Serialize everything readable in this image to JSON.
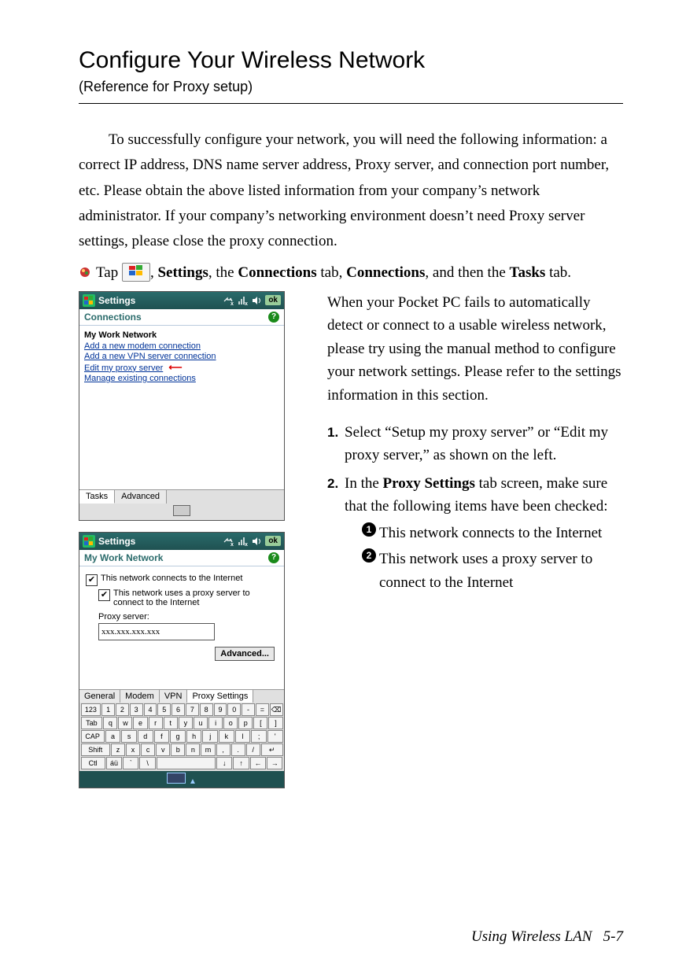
{
  "title": "Configure Your Wireless Network",
  "subtitle": "(Reference for Proxy setup)",
  "intro": "To successfully configure your network, you will need the following information: a correct IP address, DNS name server address, Proxy server, and connection port number, etc. Please obtain the above listed information from your company’s network administrator. If your company’s networking environment doesn’t need Proxy server settings, please close the proxy connection.",
  "instruction": {
    "pre": "Tap ",
    "post1": ", ",
    "settings": "Settings",
    "post2": ", the ",
    "connections_tab": "Connections",
    "post3": " tab, ",
    "connections": "Connections",
    "post4": ", and then the ",
    "tasks": "Tasks",
    "post5": " tab."
  },
  "right": {
    "para": "When your Pocket PC fails to automatically detect or connect to a usable wireless network, please try using the manual method to configure your network settings. Please refer to the settings information in this section.",
    "step1_num": "1.",
    "step1": "Select “Setup my proxy server” or “Edit my proxy server,” as shown on the left.",
    "step2_num": "2.",
    "step2_a": "In the ",
    "step2_b": "Proxy Settings",
    "step2_c": " tab screen, make sure that the following items have been checked:",
    "sub1_badge": "1",
    "sub1": "This network connects to the Internet",
    "sub2_badge": "2",
    "sub2": "This network uses a proxy server to connect to the Internet"
  },
  "ppc1": {
    "title": "Settings",
    "ok": "ok",
    "subhead": "Connections",
    "section": "My Work Network",
    "links": {
      "l1": "Add a new modem connection",
      "l2": "Add a new VPN server connection",
      "l3": "Edit my proxy server",
      "l4": "Manage existing connections"
    },
    "tabs": {
      "tasks": "Tasks",
      "advanced": "Advanced"
    }
  },
  "ppc2": {
    "title": "Settings",
    "ok": "ok",
    "subhead": "My Work Network",
    "chk1": "This network connects to the Internet",
    "chk2": "This network uses a proxy server to connect to the Internet",
    "proxy_label": "Proxy server:",
    "proxy_value": "xxx.xxx.xxx.xxx",
    "advanced_btn": "Advanced...",
    "tabs": {
      "general": "General",
      "modem": "Modem",
      "vpn": "VPN",
      "proxy": "Proxy Settings"
    },
    "osk": {
      "r1": [
        "123",
        "1",
        "2",
        "3",
        "4",
        "5",
        "6",
        "7",
        "8",
        "9",
        "0",
        "-",
        "=",
        "⌫"
      ],
      "r2": [
        "Tab",
        "q",
        "w",
        "e",
        "r",
        "t",
        "y",
        "u",
        "i",
        "o",
        "p",
        "[",
        "]"
      ],
      "r3": [
        "CAP",
        "a",
        "s",
        "d",
        "f",
        "g",
        "h",
        "j",
        "k",
        "l",
        ";",
        "'"
      ],
      "r4": [
        "Shift",
        "z",
        "x",
        "c",
        "v",
        "b",
        "n",
        "m",
        ",",
        ".",
        "/",
        "↵"
      ],
      "r5": [
        "Ctl",
        "áü",
        "`",
        "\\",
        " ",
        "↓",
        "↑",
        "←",
        "→"
      ]
    }
  },
  "footer": {
    "chapter": "Using Wireless LAN",
    "page": "5-7"
  }
}
